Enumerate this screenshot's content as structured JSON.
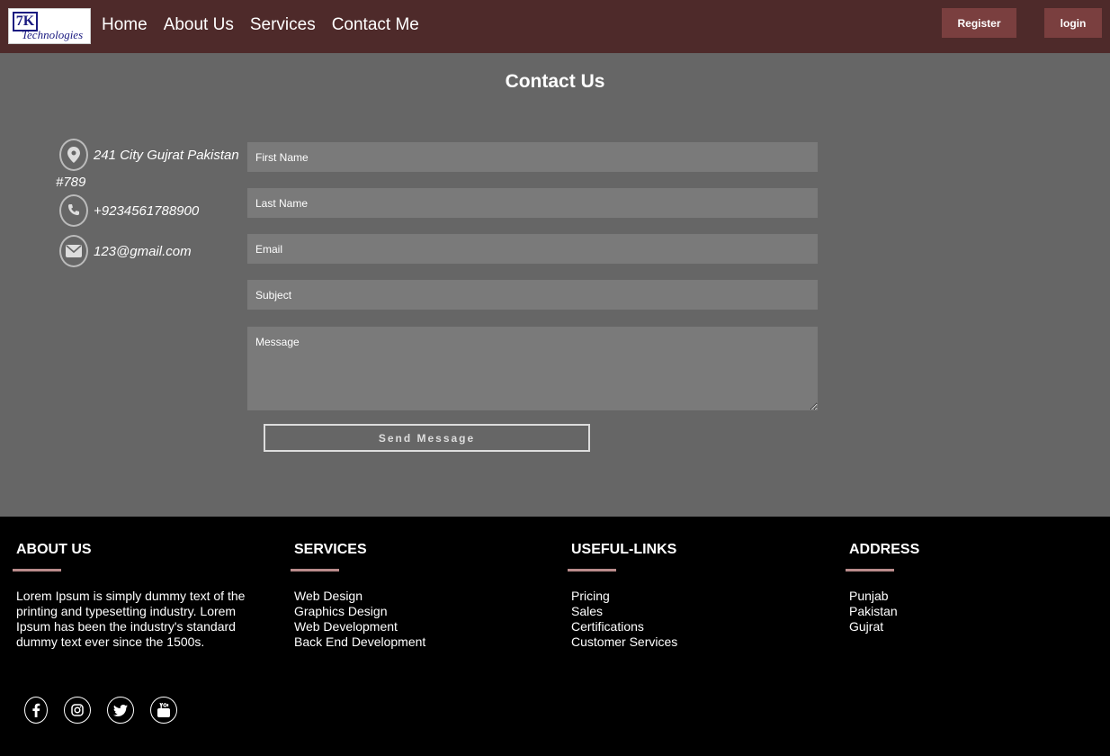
{
  "brand": {
    "logo_mark": "7K",
    "logo_text": "Technologies"
  },
  "nav": {
    "links": [
      "Home",
      "About Us",
      "Services",
      "Contact Me"
    ],
    "register_label": "Register",
    "login_label": "login"
  },
  "contact": {
    "title": "Contact Us",
    "address_line1": "241 City Gujrat Pakistan",
    "address_line2": "#789",
    "phone": "+9234561788900",
    "email": "123@gmail.com",
    "form": {
      "first_name_placeholder": "First Name",
      "last_name_placeholder": "Last Name",
      "email_placeholder": "Email",
      "subject_placeholder": "Subject",
      "message_placeholder": "Message",
      "send_label": "Send Message"
    }
  },
  "footer": {
    "about": {
      "heading": "ABOUT US",
      "text": "Lorem Ipsum is simply dummy text of the printing and typesetting industry. Lorem Ipsum has been the industry's standard dummy text ever since the 1500s."
    },
    "services": {
      "heading": "SERVICES",
      "items": [
        "Web Design",
        "Graphics Design",
        "Web Development",
        "Back End Development"
      ]
    },
    "useful_links": {
      "heading": "USEFUL-LINKS",
      "items": [
        "Pricing",
        "Sales",
        "Certifications",
        "Customer Services"
      ]
    },
    "address": {
      "heading": "ADDRESS",
      "items": [
        "Punjab",
        "Pakistan",
        "Gujrat"
      ]
    },
    "socials": [
      "facebook-icon",
      "instagram-icon",
      "twitter-icon",
      "youtube-icon"
    ]
  },
  "colors": {
    "navbar_bg": "#4e2a2a",
    "button_bg": "#7a3f3f",
    "contact_bg": "#666666",
    "footer_bg": "#000000",
    "heading_underline": "#b98b8b"
  }
}
